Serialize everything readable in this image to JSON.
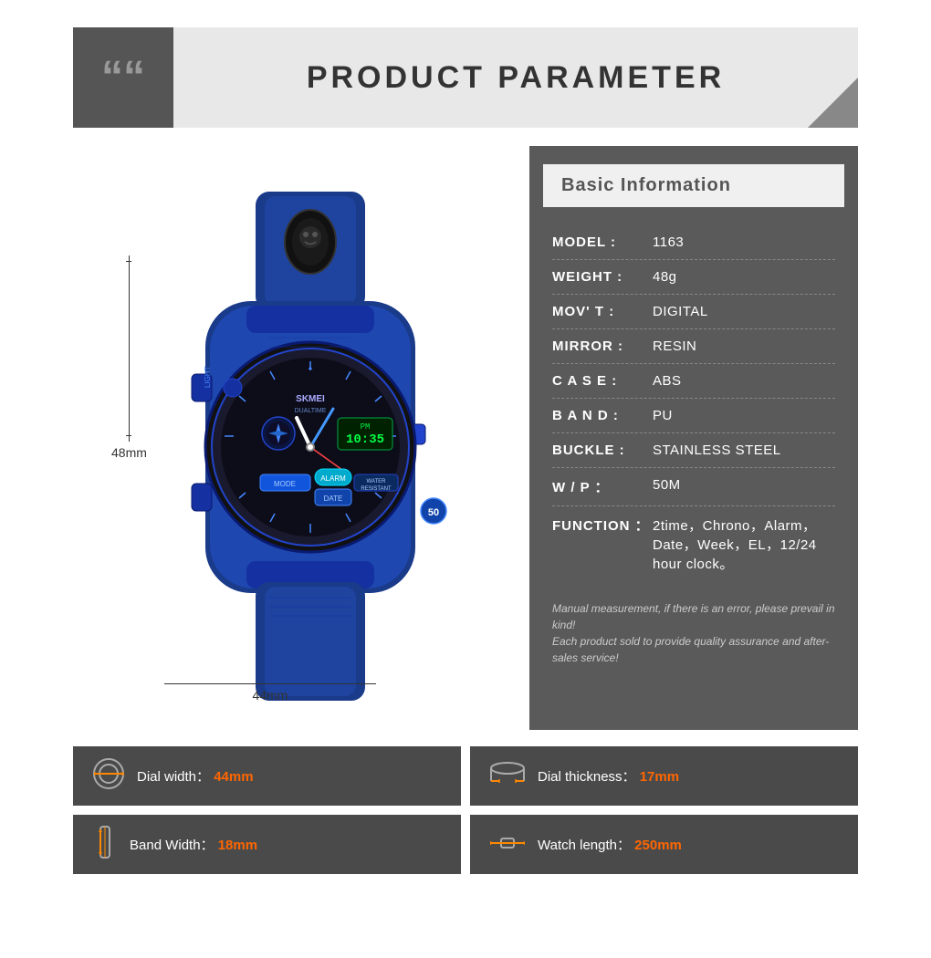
{
  "header": {
    "title": "PRODUCT PARAMETER",
    "quote_icon": "““"
  },
  "info": {
    "section_title": "Basic Information",
    "rows": [
      {
        "label": "MODEL :",
        "value": "1163"
      },
      {
        "label": "WEIGHT :",
        "value": "48g"
      },
      {
        "label": "MOV’ T :",
        "value": "DIGITAL"
      },
      {
        "label": "MIRROR :",
        "value": "RESIN"
      },
      {
        "label": "C A S E :",
        "value": "ABS"
      },
      {
        "label": "B A N D :",
        "value": "PU"
      },
      {
        "label": "BUCKLE :",
        "value": "STAINLESS STEEL"
      },
      {
        "label": "W / P :",
        "value": "50M"
      },
      {
        "label": "FUNCTION :",
        "value": "2time，Chrono，Alarm，Date，Week，EL，12/24 hour clock。"
      }
    ],
    "note_line1": "Manual measurement, if there is an error, please prevail in kind!",
    "note_line2": "Each product sold to provide quality assurance and after-sales service!"
  },
  "dimensions": {
    "height_label": "48mm",
    "width_label": "44mm"
  },
  "specs": [
    {
      "icon": "⌚",
      "label": "Dial width：",
      "value": "44mm",
      "icon_type": "dial-width"
    },
    {
      "icon": "↔",
      "label": "Dial thickness：",
      "value": "17mm",
      "icon_type": "dial-thickness"
    },
    {
      "icon": "↔",
      "label": "Band Width：",
      "value": "18mm",
      "icon_type": "band-width"
    },
    {
      "icon": "⇔",
      "label": "Watch length：",
      "value": "250mm",
      "icon_type": "watch-length"
    }
  ]
}
